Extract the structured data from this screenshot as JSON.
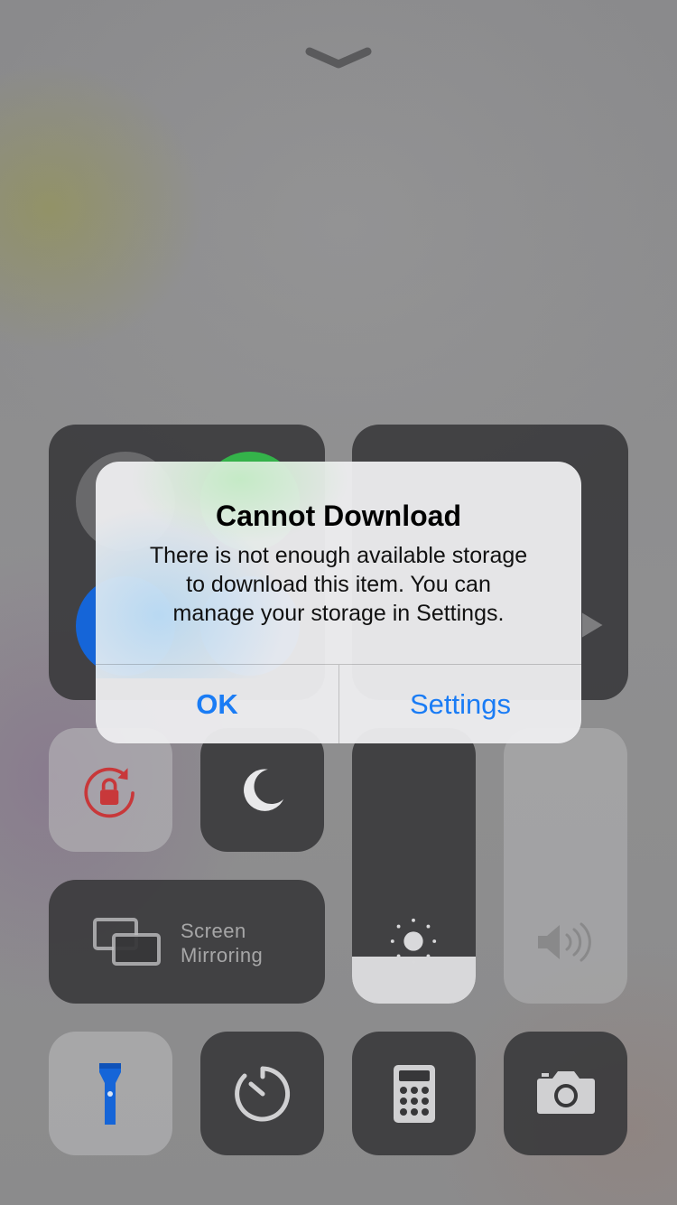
{
  "control_center": {
    "dismiss_icon": "chevron-down-icon",
    "connectivity_tile": {
      "icons": [
        "airplane-mode-icon",
        "cellular-data-icon",
        "wifi-icon",
        "bluetooth-icon"
      ]
    },
    "media_tile": {
      "icon": "play-icon"
    },
    "rotation_lock": {
      "icon": "rotation-lock-icon",
      "color": "#c8383a"
    },
    "do_not_disturb": {
      "icon": "moon-icon"
    },
    "screen_mirroring": {
      "icon": "screen-mirroring-icon",
      "label_line1": "Screen",
      "label_line2": "Mirroring"
    },
    "brightness": {
      "icon": "sun-icon",
      "level": 0.17
    },
    "volume": {
      "icon": "speaker-icon",
      "level": 0.0
    },
    "flashlight": {
      "icon": "flashlight-icon",
      "color": "#1565d8"
    },
    "timer": {
      "icon": "timer-icon"
    },
    "calculator": {
      "icon": "calculator-icon"
    },
    "camera": {
      "icon": "camera-icon"
    }
  },
  "alert": {
    "title": "Cannot Download",
    "message": "There is not enough available storage\nto download this item.  You can\nmanage your storage in Settings.",
    "ok_label": "OK",
    "settings_label": "Settings",
    "button_color": "#1a7cf5"
  }
}
